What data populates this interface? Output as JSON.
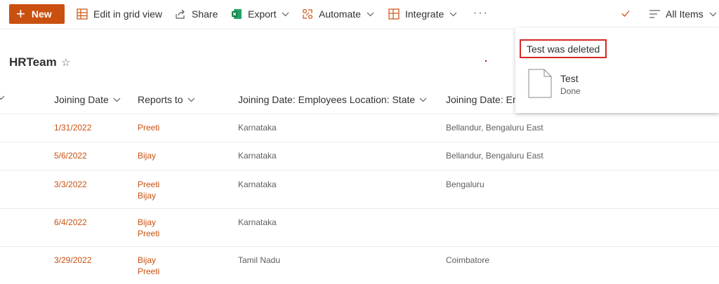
{
  "command_bar": {
    "new_label": "New",
    "edit_grid_label": "Edit in grid view",
    "share_label": "Share",
    "export_label": "Export",
    "automate_label": "Automate",
    "integrate_label": "Integrate",
    "more_label": "···",
    "view_label": "All Items"
  },
  "page": {
    "title": "HRTeam"
  },
  "table": {
    "columns": [
      "Joining Date",
      "Reports to",
      "Joining Date: Employees Location: State",
      "Joining Date: Em"
    ],
    "rows": [
      {
        "date": "1/31/2022",
        "reports": [
          "Preeti"
        ],
        "state": "Karnataka",
        "location": "Bellandur, Bengaluru East"
      },
      {
        "date": "5/6/2022",
        "reports": [
          "Bijay"
        ],
        "state": "Karnataka",
        "location": "Bellandur, Bengaluru East"
      },
      {
        "date": "3/3/2022",
        "reports": [
          "Preeti",
          "Bijay"
        ],
        "state": "Karnataka",
        "location": "Bengaluru"
      },
      {
        "date": "6/4/2022",
        "reports": [
          "Bijay",
          "Preeti"
        ],
        "state": "Karnataka",
        "location": ""
      },
      {
        "date": "3/29/2022",
        "reports": [
          "Bijay",
          "Preeti"
        ],
        "state": "Tamil Nadu",
        "location": "Coimbatore"
      }
    ]
  },
  "notification": {
    "message": "Test was deleted",
    "file_name": "Test",
    "file_status": "Done"
  },
  "colors": {
    "accent": "#ca5010",
    "excel_green": "#107c41",
    "highlight_border": "#d62828"
  },
  "icons": [
    "plus-icon",
    "grid-icon",
    "share-icon",
    "excel-icon",
    "automate-icon",
    "integrate-icon",
    "more-icon",
    "check-icon",
    "view-lines-icon",
    "star-icon",
    "chevron-down-icon",
    "file-icon"
  ]
}
